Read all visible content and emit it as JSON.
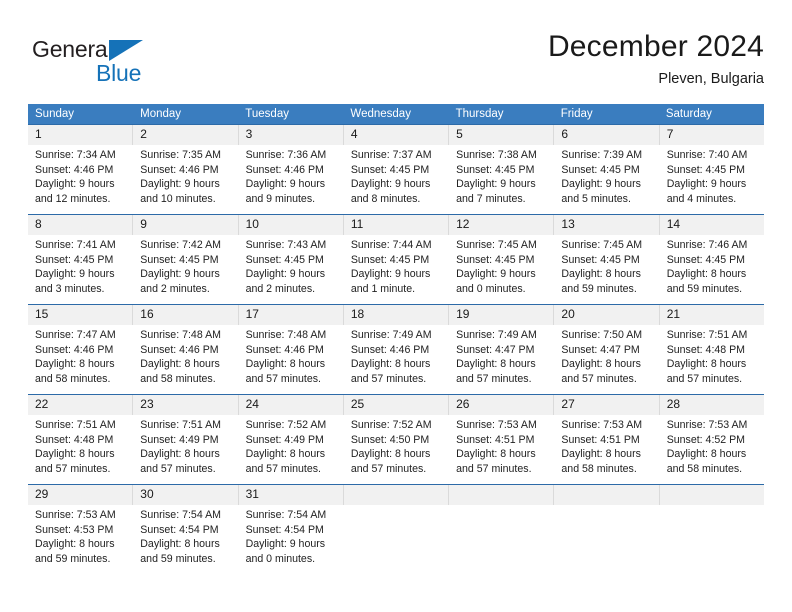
{
  "brand": {
    "word1": "General",
    "word2": "Blue",
    "triangle_color": "#1572b8",
    "text_color": "#231f20"
  },
  "header": {
    "title": "December 2024",
    "subtitle": "Pleven, Bulgaria"
  },
  "theme": {
    "header_bg": "#3a7dbf",
    "header_text": "#ffffff",
    "daynum_bg": "#f1f1f1",
    "rule_color": "#2c6aa8",
    "body_text": "#222222"
  },
  "weekdays": [
    "Sunday",
    "Monday",
    "Tuesday",
    "Wednesday",
    "Thursday",
    "Friday",
    "Saturday"
  ],
  "weeks": [
    [
      {
        "day": "1",
        "sunrise": "Sunrise: 7:34 AM",
        "sunset": "Sunset: 4:46 PM",
        "daylight1": "Daylight: 9 hours",
        "daylight2": "and 12 minutes."
      },
      {
        "day": "2",
        "sunrise": "Sunrise: 7:35 AM",
        "sunset": "Sunset: 4:46 PM",
        "daylight1": "Daylight: 9 hours",
        "daylight2": "and 10 minutes."
      },
      {
        "day": "3",
        "sunrise": "Sunrise: 7:36 AM",
        "sunset": "Sunset: 4:46 PM",
        "daylight1": "Daylight: 9 hours",
        "daylight2": "and 9 minutes."
      },
      {
        "day": "4",
        "sunrise": "Sunrise: 7:37 AM",
        "sunset": "Sunset: 4:45 PM",
        "daylight1": "Daylight: 9 hours",
        "daylight2": "and 8 minutes."
      },
      {
        "day": "5",
        "sunrise": "Sunrise: 7:38 AM",
        "sunset": "Sunset: 4:45 PM",
        "daylight1": "Daylight: 9 hours",
        "daylight2": "and 7 minutes."
      },
      {
        "day": "6",
        "sunrise": "Sunrise: 7:39 AM",
        "sunset": "Sunset: 4:45 PM",
        "daylight1": "Daylight: 9 hours",
        "daylight2": "and 5 minutes."
      },
      {
        "day": "7",
        "sunrise": "Sunrise: 7:40 AM",
        "sunset": "Sunset: 4:45 PM",
        "daylight1": "Daylight: 9 hours",
        "daylight2": "and 4 minutes."
      }
    ],
    [
      {
        "day": "8",
        "sunrise": "Sunrise: 7:41 AM",
        "sunset": "Sunset: 4:45 PM",
        "daylight1": "Daylight: 9 hours",
        "daylight2": "and 3 minutes."
      },
      {
        "day": "9",
        "sunrise": "Sunrise: 7:42 AM",
        "sunset": "Sunset: 4:45 PM",
        "daylight1": "Daylight: 9 hours",
        "daylight2": "and 2 minutes."
      },
      {
        "day": "10",
        "sunrise": "Sunrise: 7:43 AM",
        "sunset": "Sunset: 4:45 PM",
        "daylight1": "Daylight: 9 hours",
        "daylight2": "and 2 minutes."
      },
      {
        "day": "11",
        "sunrise": "Sunrise: 7:44 AM",
        "sunset": "Sunset: 4:45 PM",
        "daylight1": "Daylight: 9 hours",
        "daylight2": "and 1 minute."
      },
      {
        "day": "12",
        "sunrise": "Sunrise: 7:45 AM",
        "sunset": "Sunset: 4:45 PM",
        "daylight1": "Daylight: 9 hours",
        "daylight2": "and 0 minutes."
      },
      {
        "day": "13",
        "sunrise": "Sunrise: 7:45 AM",
        "sunset": "Sunset: 4:45 PM",
        "daylight1": "Daylight: 8 hours",
        "daylight2": "and 59 minutes."
      },
      {
        "day": "14",
        "sunrise": "Sunrise: 7:46 AM",
        "sunset": "Sunset: 4:45 PM",
        "daylight1": "Daylight: 8 hours",
        "daylight2": "and 59 minutes."
      }
    ],
    [
      {
        "day": "15",
        "sunrise": "Sunrise: 7:47 AM",
        "sunset": "Sunset: 4:46 PM",
        "daylight1": "Daylight: 8 hours",
        "daylight2": "and 58 minutes."
      },
      {
        "day": "16",
        "sunrise": "Sunrise: 7:48 AM",
        "sunset": "Sunset: 4:46 PM",
        "daylight1": "Daylight: 8 hours",
        "daylight2": "and 58 minutes."
      },
      {
        "day": "17",
        "sunrise": "Sunrise: 7:48 AM",
        "sunset": "Sunset: 4:46 PM",
        "daylight1": "Daylight: 8 hours",
        "daylight2": "and 57 minutes."
      },
      {
        "day": "18",
        "sunrise": "Sunrise: 7:49 AM",
        "sunset": "Sunset: 4:46 PM",
        "daylight1": "Daylight: 8 hours",
        "daylight2": "and 57 minutes."
      },
      {
        "day": "19",
        "sunrise": "Sunrise: 7:49 AM",
        "sunset": "Sunset: 4:47 PM",
        "daylight1": "Daylight: 8 hours",
        "daylight2": "and 57 minutes."
      },
      {
        "day": "20",
        "sunrise": "Sunrise: 7:50 AM",
        "sunset": "Sunset: 4:47 PM",
        "daylight1": "Daylight: 8 hours",
        "daylight2": "and 57 minutes."
      },
      {
        "day": "21",
        "sunrise": "Sunrise: 7:51 AM",
        "sunset": "Sunset: 4:48 PM",
        "daylight1": "Daylight: 8 hours",
        "daylight2": "and 57 minutes."
      }
    ],
    [
      {
        "day": "22",
        "sunrise": "Sunrise: 7:51 AM",
        "sunset": "Sunset: 4:48 PM",
        "daylight1": "Daylight: 8 hours",
        "daylight2": "and 57 minutes."
      },
      {
        "day": "23",
        "sunrise": "Sunrise: 7:51 AM",
        "sunset": "Sunset: 4:49 PM",
        "daylight1": "Daylight: 8 hours",
        "daylight2": "and 57 minutes."
      },
      {
        "day": "24",
        "sunrise": "Sunrise: 7:52 AM",
        "sunset": "Sunset: 4:49 PM",
        "daylight1": "Daylight: 8 hours",
        "daylight2": "and 57 minutes."
      },
      {
        "day": "25",
        "sunrise": "Sunrise: 7:52 AM",
        "sunset": "Sunset: 4:50 PM",
        "daylight1": "Daylight: 8 hours",
        "daylight2": "and 57 minutes."
      },
      {
        "day": "26",
        "sunrise": "Sunrise: 7:53 AM",
        "sunset": "Sunset: 4:51 PM",
        "daylight1": "Daylight: 8 hours",
        "daylight2": "and 57 minutes."
      },
      {
        "day": "27",
        "sunrise": "Sunrise: 7:53 AM",
        "sunset": "Sunset: 4:51 PM",
        "daylight1": "Daylight: 8 hours",
        "daylight2": "and 58 minutes."
      },
      {
        "day": "28",
        "sunrise": "Sunrise: 7:53 AM",
        "sunset": "Sunset: 4:52 PM",
        "daylight1": "Daylight: 8 hours",
        "daylight2": "and 58 minutes."
      }
    ],
    [
      {
        "day": "29",
        "sunrise": "Sunrise: 7:53 AM",
        "sunset": "Sunset: 4:53 PM",
        "daylight1": "Daylight: 8 hours",
        "daylight2": "and 59 minutes."
      },
      {
        "day": "30",
        "sunrise": "Sunrise: 7:54 AM",
        "sunset": "Sunset: 4:54 PM",
        "daylight1": "Daylight: 8 hours",
        "daylight2": "and 59 minutes."
      },
      {
        "day": "31",
        "sunrise": "Sunrise: 7:54 AM",
        "sunset": "Sunset: 4:54 PM",
        "daylight1": "Daylight: 9 hours",
        "daylight2": "and 0 minutes."
      },
      {
        "day": "",
        "sunrise": "",
        "sunset": "",
        "daylight1": "",
        "daylight2": ""
      },
      {
        "day": "",
        "sunrise": "",
        "sunset": "",
        "daylight1": "",
        "daylight2": ""
      },
      {
        "day": "",
        "sunrise": "",
        "sunset": "",
        "daylight1": "",
        "daylight2": ""
      },
      {
        "day": "",
        "sunrise": "",
        "sunset": "",
        "daylight1": "",
        "daylight2": ""
      }
    ]
  ]
}
